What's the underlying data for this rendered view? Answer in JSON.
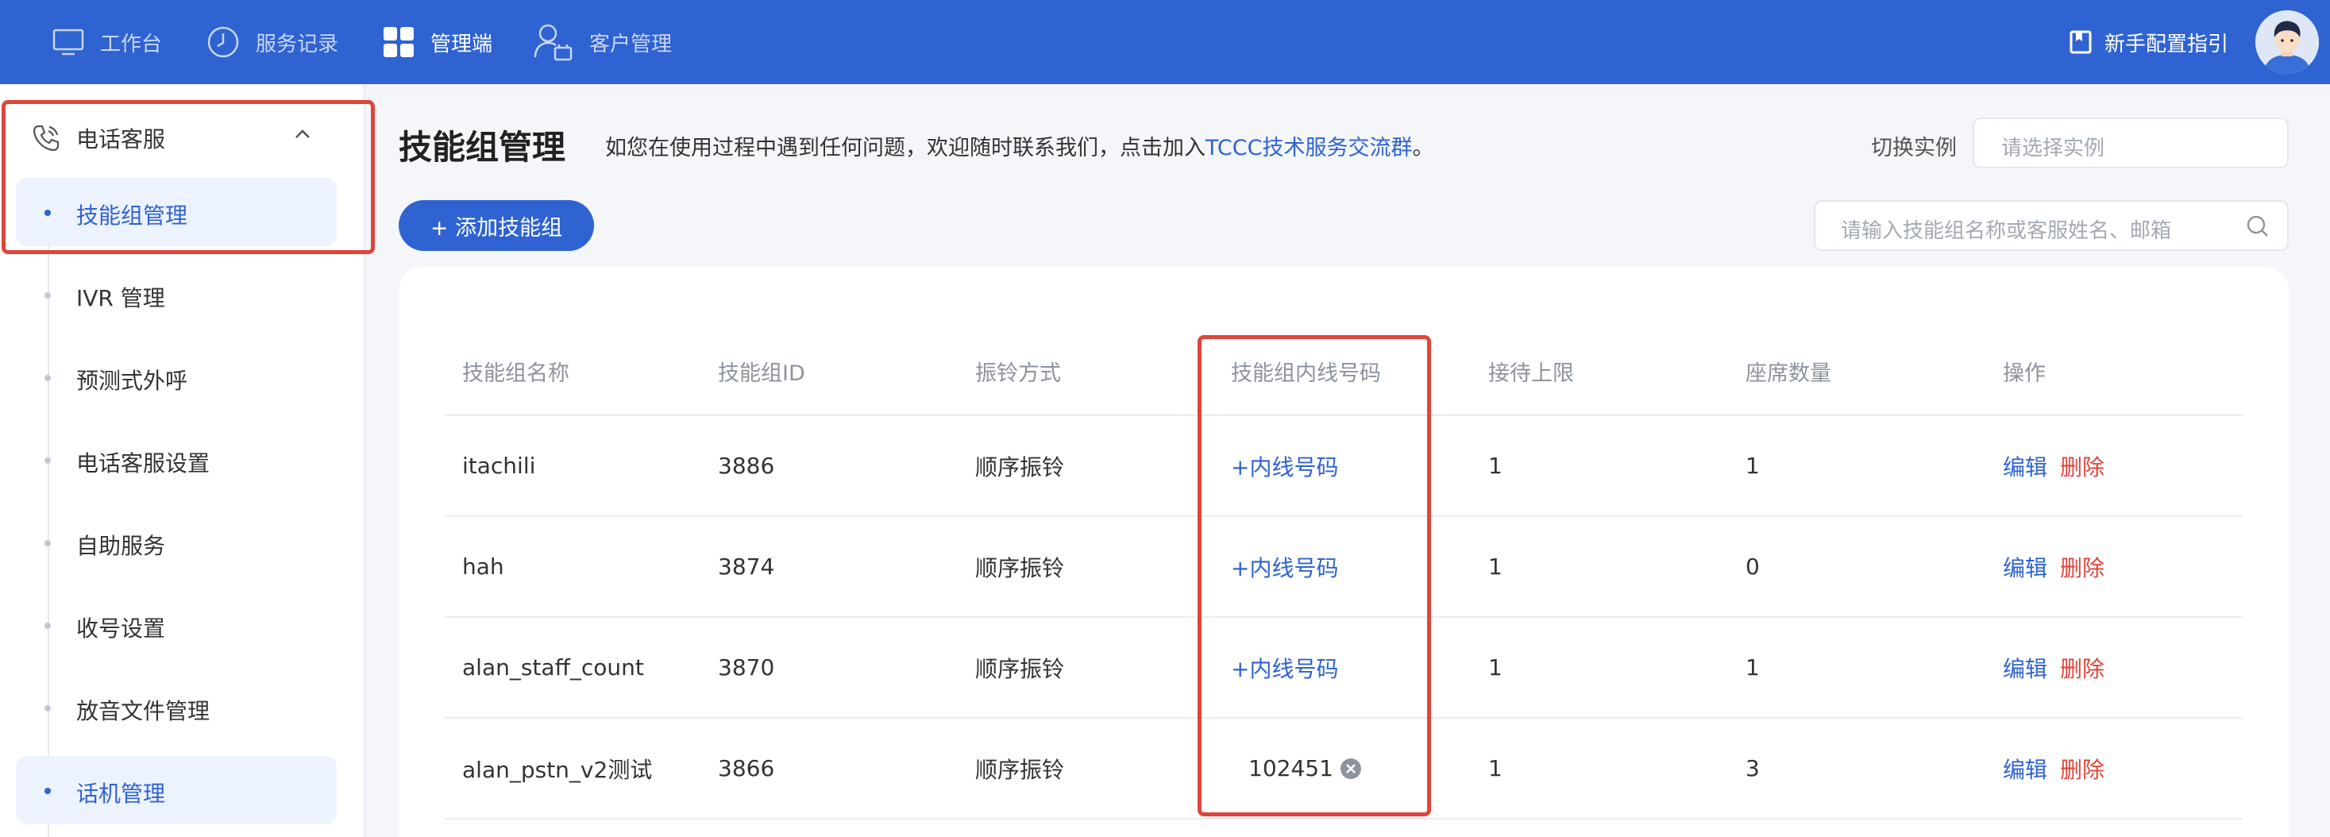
{
  "topnav": {
    "items": [
      {
        "label": "工作台",
        "icon": "monitor-icon",
        "active": false
      },
      {
        "label": "服务记录",
        "icon": "clock-icon",
        "active": false
      },
      {
        "label": "管理端",
        "icon": "grid-icon",
        "active": true
      },
      {
        "label": "客户管理",
        "icon": "customer-icon",
        "active": false
      }
    ],
    "guide_label": "新手配置指引",
    "guide_icon": "bookmark-icon",
    "accent": "#2f63d2"
  },
  "sidebar": {
    "group_label": "电话客服",
    "items": [
      {
        "label": "技能组管理",
        "active": true
      },
      {
        "label": "IVR 管理",
        "active": false
      },
      {
        "label": "预测式外呼",
        "active": false
      },
      {
        "label": "电话客服设置",
        "active": false
      },
      {
        "label": "自助服务",
        "active": false
      },
      {
        "label": "收号设置",
        "active": false
      },
      {
        "label": "放音文件管理",
        "active": false
      },
      {
        "label": "话机管理",
        "active": true
      }
    ]
  },
  "header": {
    "title": "技能组管理",
    "notice_prefix": "如您在使用过程中遇到任何问题，欢迎随时联系我们，点击加入",
    "notice_link": "TCCC技术服务交流群",
    "notice_suffix": "。",
    "switch_label": "切换实例",
    "select_placeholder": "请选择实例"
  },
  "toolbar": {
    "add_label": "+ 添加技能组",
    "search_placeholder": "请输入技能组名称或客服姓名、邮箱"
  },
  "table": {
    "columns": [
      "技能组名称",
      "技能组ID",
      "振铃方式",
      "技能组内线号码",
      "接待上限",
      "座席数量",
      "操作"
    ],
    "rows": [
      {
        "name": "itachili",
        "id": "3886",
        "ring": "顺序振铃",
        "ext": "+内线号码",
        "ext_set": false,
        "limit": "1",
        "seats": "1"
      },
      {
        "name": "hah",
        "id": "3874",
        "ring": "顺序振铃",
        "ext": "+内线号码",
        "ext_set": false,
        "limit": "1",
        "seats": "0"
      },
      {
        "name": "alan_staff_count",
        "id": "3870",
        "ring": "顺序振铃",
        "ext": "+内线号码",
        "ext_set": false,
        "limit": "1",
        "seats": "1"
      },
      {
        "name": "alan_pstn_v2测试",
        "id": "3866",
        "ring": "顺序振铃",
        "ext": "102451",
        "ext_set": true,
        "limit": "1",
        "seats": "3"
      }
    ],
    "edit_label": "编辑",
    "delete_label": "删除"
  },
  "highlight_color": "#e0443a"
}
